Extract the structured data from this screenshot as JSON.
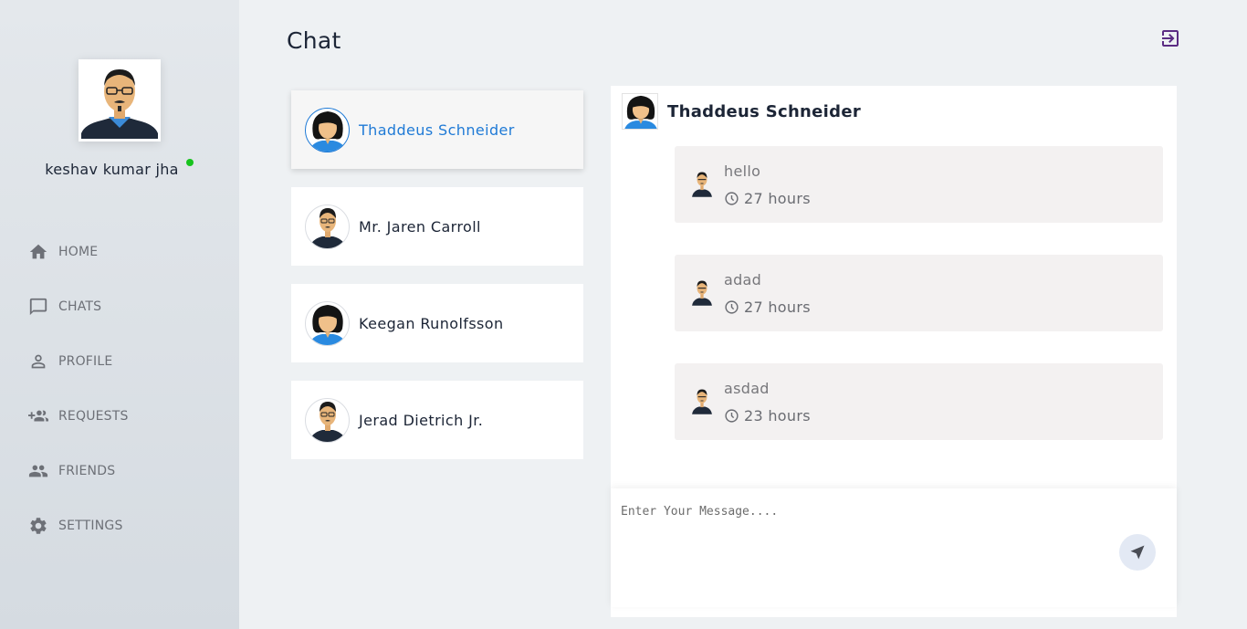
{
  "user": {
    "name": "keshav kumar jha",
    "status_color": "#17c31d"
  },
  "nav": [
    {
      "label": "HOME",
      "icon": "home-icon"
    },
    {
      "label": "CHATS",
      "icon": "chat-bubble-icon"
    },
    {
      "label": "PROFILE",
      "icon": "person-icon"
    },
    {
      "label": "REQUESTS",
      "icon": "add-group-icon"
    },
    {
      "label": "FRIENDS",
      "icon": "group-icon"
    },
    {
      "label": "SETTINGS",
      "icon": "gear-icon"
    }
  ],
  "header": {
    "title": "Chat",
    "logout_icon": "logout-icon"
  },
  "contacts": [
    {
      "name": "Thaddeus Schneider",
      "avatar": "female-avatar",
      "active": true
    },
    {
      "name": "Mr. Jaren Carroll",
      "avatar": "male-avatar",
      "active": false
    },
    {
      "name": "Keegan Runolfsson",
      "avatar": "female-avatar",
      "active": false
    },
    {
      "name": "Jerad Dietrich Jr.",
      "avatar": "male-avatar",
      "active": false
    }
  ],
  "chat": {
    "recipient": "Thaddeus Schneider",
    "messages": [
      {
        "text": "hello",
        "time": "27 hours"
      },
      {
        "text": "adad",
        "time": "27 hours"
      },
      {
        "text": "asdad",
        "time": "23 hours"
      }
    ],
    "input_placeholder": "Enter Your Message....",
    "send_icon": "send-icon"
  },
  "colors": {
    "accent": "#1f7ad6",
    "sidebar_text": "#6d7077",
    "logout": "#5b2c83"
  }
}
